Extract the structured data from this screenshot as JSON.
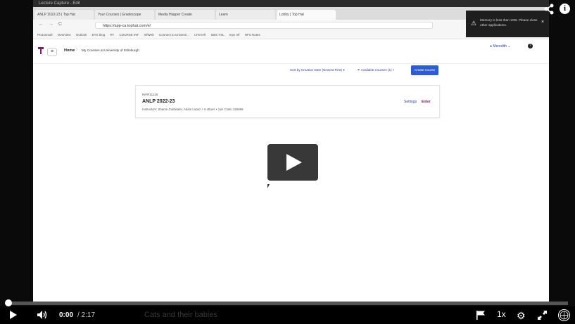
{
  "os_bar": {
    "title": "Lecture Capture - Edit"
  },
  "browser": {
    "tabs": [
      {
        "label": "ANLP 2022-23 | Top Hat"
      },
      {
        "label": "Your Courses | Gradescope"
      },
      {
        "label": "Media Hopper Create"
      },
      {
        "label": "Learn"
      },
      {
        "label": "Lobby | Top Hat",
        "active": true
      }
    ],
    "nav_glyphs": [
      "←",
      "→",
      "C"
    ],
    "url": "https://app-ca.tophat.com/e/",
    "bookmarks": [
      "Protonmail",
      "Overview",
      "Outlook",
      "ETS blog",
      "RT",
      "COURSE INF",
      "InfWeb",
      "Connect to Universi...",
      "LTM Infr",
      "DBS TSL",
      "Inpx Inf",
      "NFS Notes"
    ]
  },
  "app": {
    "home": "Home",
    "breadcrumb": "My Courses at University of Edinburgh",
    "user": "Meredith",
    "help": "?",
    "sort_label": "Sort by Creation Date (Newest First)",
    "filter_label": "Available Courses (1)",
    "create_button": "Create Course",
    "course": {
      "code": "INFR11126",
      "title": "ANLP 2022-23",
      "meta": "Instructors: Sharon Goldwater, Adam Lopez + 6 others  •  Join Code: 225659",
      "settings": "Settings",
      "enter": "Enter"
    }
  },
  "toast": {
    "text": "Memory is less than 1GB. Please close other applications."
  },
  "player": {
    "current_time": "0:00",
    "duration": "/ 2:17",
    "progress": 0.0,
    "caption": "Cats and their babies",
    "speed": "1x",
    "info": "i"
  },
  "colors": {
    "accent": "#2f5bd3",
    "brand": "#7a1f5c"
  }
}
